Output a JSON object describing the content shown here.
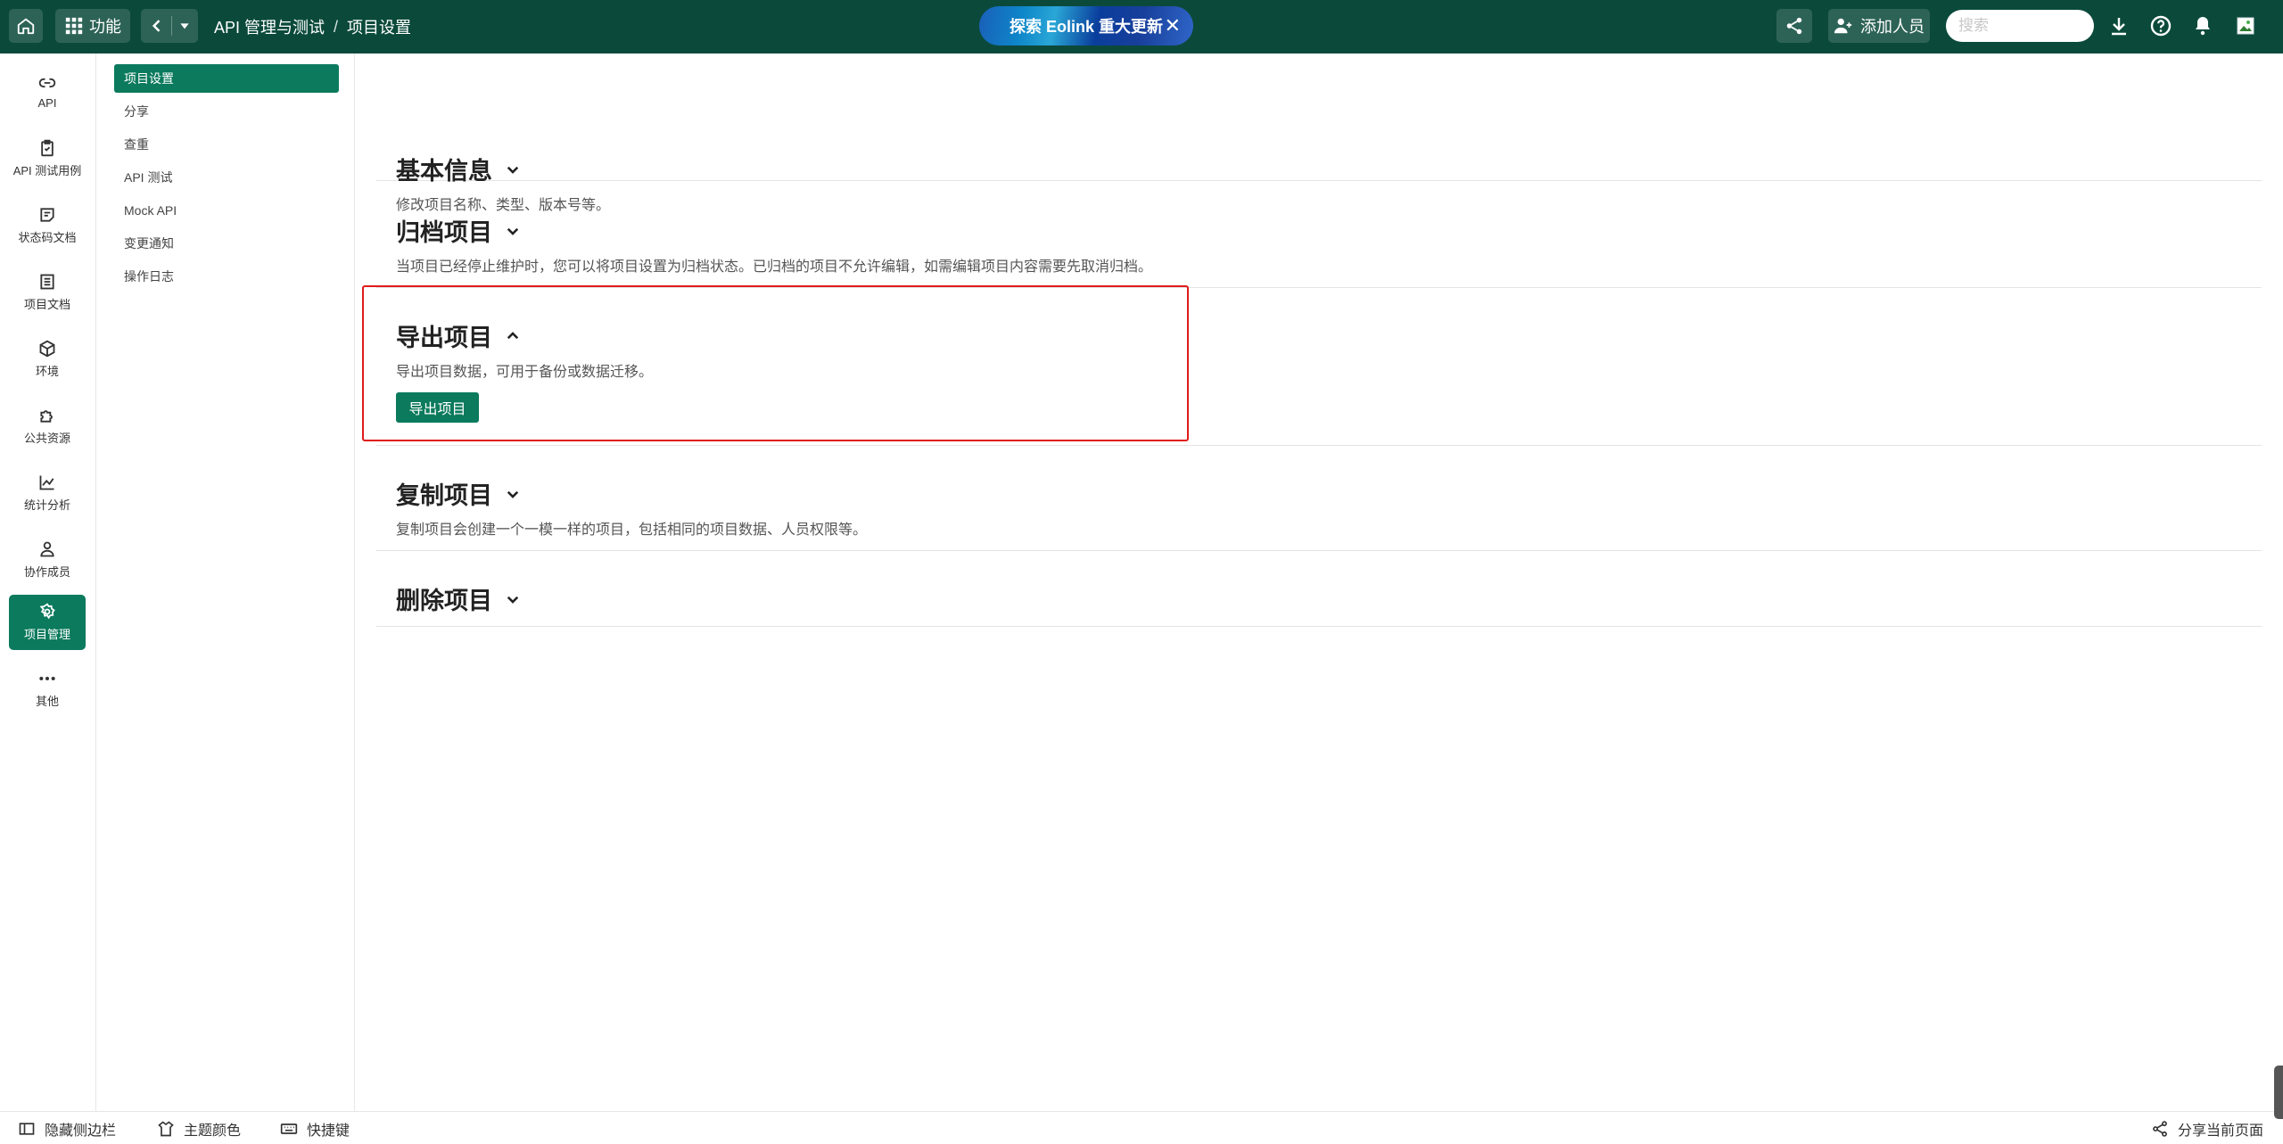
{
  "topbar": {
    "features_label": "功能",
    "breadcrumb": {
      "project": "API 管理与测试",
      "separator": "/",
      "current": "项目设置"
    },
    "promo_text": "探索 Eolink 重大更新",
    "promo_close": "✕",
    "add_member_label": "添加人员",
    "search_placeholder": "搜索"
  },
  "rail": {
    "items": [
      {
        "label": "API",
        "icon": "link-icon"
      },
      {
        "label": "API 测试用例",
        "icon": "clipboard-icon"
      },
      {
        "label": "状态码文档",
        "icon": "note-icon"
      },
      {
        "label": "项目文档",
        "icon": "document-icon"
      },
      {
        "label": "环境",
        "icon": "cube-icon"
      },
      {
        "label": "公共资源",
        "icon": "puzzle-icon"
      },
      {
        "label": "统计分析",
        "icon": "chart-icon"
      },
      {
        "label": "协作成员",
        "icon": "members-icon"
      },
      {
        "label": "项目管理",
        "icon": "gear-icon",
        "active": true
      },
      {
        "label": "其他",
        "icon": "more-icon"
      }
    ]
  },
  "subnav": {
    "items": [
      {
        "label": "项目设置",
        "active": true
      },
      {
        "label": "分享"
      },
      {
        "label": "查重"
      },
      {
        "label": "API 测试"
      },
      {
        "label": "Mock API"
      },
      {
        "label": "变更通知"
      },
      {
        "label": "操作日志"
      }
    ]
  },
  "sections": {
    "basic": {
      "title": "基本信息",
      "desc": "修改项目名称、类型、版本号等。"
    },
    "archive": {
      "title": "归档项目",
      "desc": "当项目已经停止维护时，您可以将项目设置为归档状态。已归档的项目不允许编辑，如需编辑项目内容需要先取消归档。"
    },
    "export": {
      "title": "导出项目",
      "desc": "导出项目数据，可用于备份或数据迁移。",
      "button": "导出项目"
    },
    "copy": {
      "title": "复制项目",
      "desc": "复制项目会创建一个一模一样的项目，包括相同的项目数据、人员权限等。"
    },
    "delete": {
      "title": "删除项目"
    }
  },
  "footer": {
    "hide_sidebar": "隐藏侧边栏",
    "theme_color": "主题颜色",
    "shortcuts": "快捷键",
    "share_page": "分享当前页面"
  },
  "colors": {
    "topbar_bg": "#0b4a3b",
    "accent": "#0b7a5d",
    "highlight_border": "#e01b1b"
  }
}
